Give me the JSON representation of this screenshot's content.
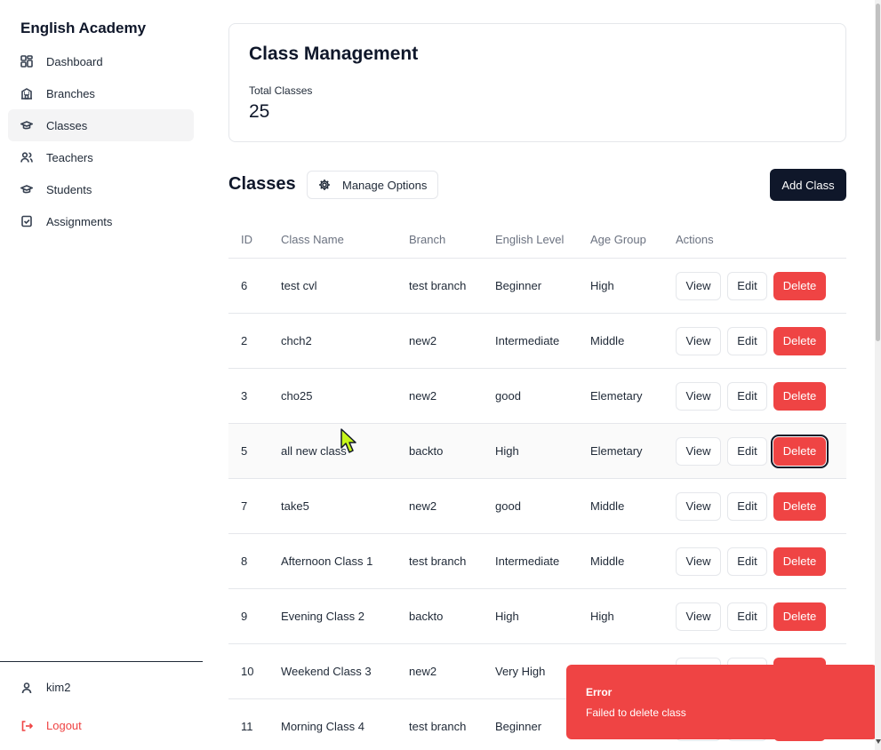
{
  "sidebar": {
    "brand": "English Academy",
    "items": [
      {
        "label": "Dashboard",
        "icon": "dashboard-icon"
      },
      {
        "label": "Branches",
        "icon": "building-icon"
      },
      {
        "label": "Classes",
        "icon": "graduation-cap-icon",
        "active": true
      },
      {
        "label": "Teachers",
        "icon": "users-icon"
      },
      {
        "label": "Students",
        "icon": "graduation-cap-icon"
      },
      {
        "label": "Assignments",
        "icon": "clipboard-check-icon"
      }
    ],
    "user": "kim2",
    "logout": "Logout"
  },
  "summary": {
    "title": "Class Management",
    "total_label": "Total Classes",
    "total_value": "25"
  },
  "section": {
    "title": "Classes",
    "manage_label": "Manage Options",
    "add_label": "Add Class"
  },
  "table": {
    "headers": [
      "ID",
      "Class Name",
      "Branch",
      "English Level",
      "Age Group",
      "Actions"
    ],
    "rows": [
      {
        "id": "6",
        "name": "test cvl",
        "branch": "test branch",
        "level": "Beginner",
        "age": "High"
      },
      {
        "id": "2",
        "name": "chch2",
        "branch": "new2",
        "level": "Intermediate",
        "age": "Middle"
      },
      {
        "id": "3",
        "name": "cho25",
        "branch": "new2",
        "level": "good",
        "age": "Elemetary"
      },
      {
        "id": "5",
        "name": "all new class",
        "branch": "backto",
        "level": "High",
        "age": "Elemetary"
      },
      {
        "id": "7",
        "name": "take5",
        "branch": "new2",
        "level": "good",
        "age": "Middle"
      },
      {
        "id": "8",
        "name": "Afternoon Class 1",
        "branch": "test branch",
        "level": "Intermediate",
        "age": "Middle"
      },
      {
        "id": "9",
        "name": "Evening Class 2",
        "branch": "backto",
        "level": "High",
        "age": "High"
      },
      {
        "id": "10",
        "name": "Weekend Class 3",
        "branch": "new2",
        "level": "Very High",
        "age": ""
      },
      {
        "id": "11",
        "name": "Morning Class 4",
        "branch": "test branch",
        "level": "Beginner",
        "age": ""
      }
    ],
    "actions": {
      "view": "View",
      "edit": "Edit",
      "delete": "Delete"
    }
  },
  "toast": {
    "title": "Error",
    "message": "Failed to delete class"
  },
  "colors": {
    "primary": "#0f172a",
    "danger": "#ef4444",
    "active_bg": "#f4f4f5",
    "border": "#e5e7eb"
  }
}
